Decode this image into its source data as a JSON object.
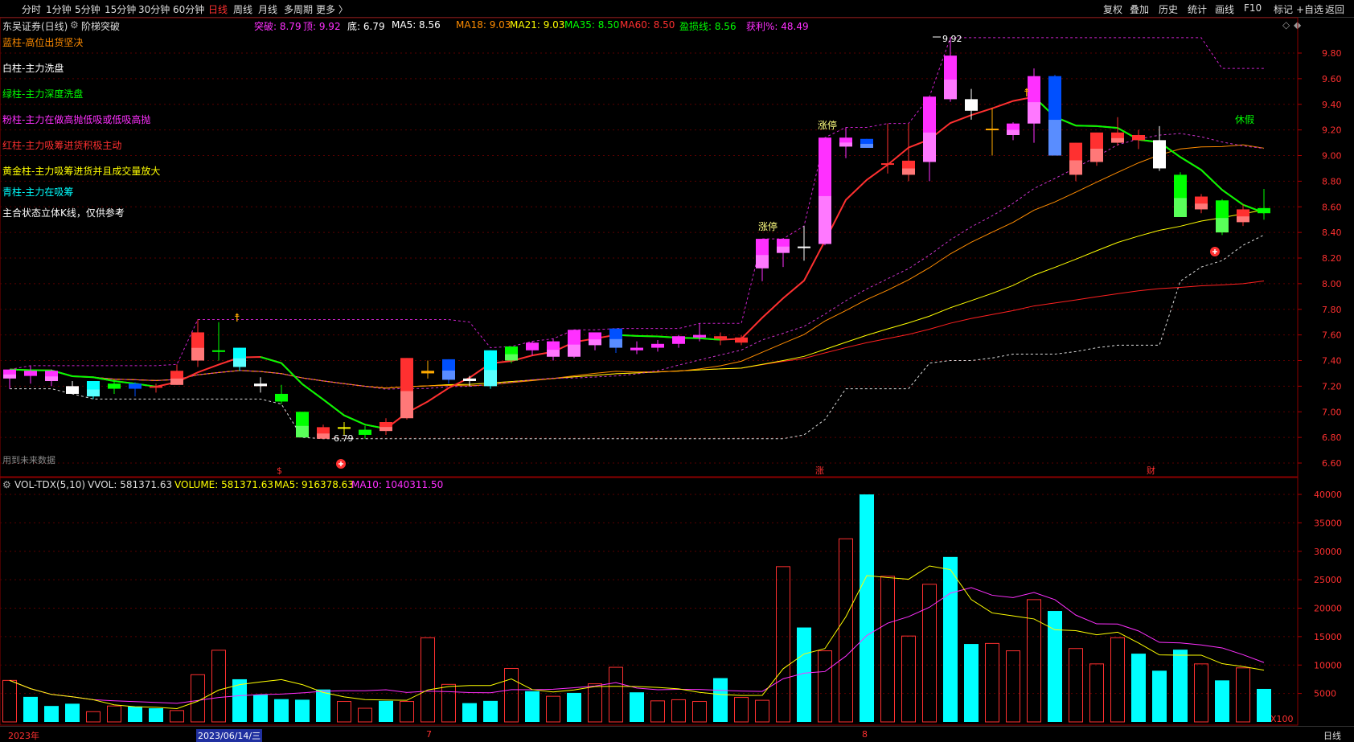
{
  "toolbar": {
    "left": [
      "分时",
      "1分钟",
      "5分钟",
      "15分钟",
      "30分钟",
      "60分钟",
      "日线",
      "周线",
      "月线",
      "多周期",
      "更多 〉"
    ],
    "active_index": 6,
    "right": [
      "复权",
      "叠加",
      "历史",
      "统计",
      "画线",
      "F10",
      "标记",
      "+自选",
      "返回"
    ]
  },
  "info": {
    "title": "东吴证券(日线)",
    "indicator_icon": "gear-icon",
    "indicator": "阶梯突破",
    "items": [
      {
        "label": "突破: ",
        "value": "8.79",
        "color": "#ff30ff"
      },
      {
        "label": "顶: ",
        "value": "9.92",
        "color": "#ff30ff"
      },
      {
        "label": "底: ",
        "value": "6.79",
        "color": "#ffffff"
      },
      {
        "label": "MA5: ",
        "value": "8.56",
        "color": "#ffffff"
      },
      {
        "label": "MA18: ",
        "value": "9.03",
        "color": "#ff8c00"
      },
      {
        "label": "MA21: ",
        "value": "9.03",
        "color": "#ffff00"
      },
      {
        "label": "MA35: ",
        "value": "8.50",
        "color": "#00ff00"
      },
      {
        "label": "MA60: ",
        "value": "8.50",
        "color": "#ff3030"
      },
      {
        "label": "盈损线: ",
        "value": "8.56",
        "color": "#00ff00"
      },
      {
        "label": "获利%: ",
        "value": "48.49",
        "color": "#ff30ff"
      }
    ],
    "right_icons": [
      "◇",
      "◆"
    ]
  },
  "legend": [
    {
      "text": "蓝柱-高位出货坚决",
      "color": "#ff8c00"
    },
    {
      "text": "白柱-主力洗盘",
      "color": "#ffffff"
    },
    {
      "text": "绿柱-主力深度洗盘",
      "color": "#00ff00"
    },
    {
      "text": "粉柱-主力在做高抛低吸或低吸高抛",
      "color": "#ff30ff"
    },
    {
      "text": "红柱-主力吸筹进货积极主动",
      "color": "#ff3030"
    },
    {
      "text": "黄金柱-主力吸筹进货并且成交量放大",
      "color": "#ffff00"
    },
    {
      "text": "青柱-主力在吸筹",
      "color": "#00ffff"
    },
    {
      "text": "主合状态立体K线，仅供参考",
      "color": "#ffffff"
    }
  ],
  "annotations": {
    "top_label": "9.92",
    "bottom_label": "6.79",
    "limit_up_1": "涨停",
    "limit_up_2": "涨停",
    "holiday": "休假",
    "future_data": "用到未来数据",
    "marker_s": "$",
    "marker_zhang": "涨",
    "marker_cai": "财"
  },
  "price_axis": [
    "9.80",
    "9.60",
    "9.40",
    "9.20",
    "9.00",
    "8.80",
    "8.60",
    "8.40",
    "8.20",
    "8.00",
    "7.80",
    "7.60",
    "7.40",
    "7.20",
    "7.00",
    "6.80",
    "6.60"
  ],
  "volume_info": {
    "name": "VOL-TDX(5,10)",
    "vvol": "VVOL: 581371.63",
    "volume": "VOLUME: 581371.63",
    "ma5": "MA5: 916378.63",
    "ma10": "MA10: 1040311.50"
  },
  "volume_axis": [
    "40000",
    "35000",
    "30000",
    "25000",
    "20000",
    "15000",
    "10000",
    "5000"
  ],
  "volume_unit": "X100",
  "date_bar": {
    "year": "2023年",
    "cursor_date": "2023/06/14/三",
    "month_7": "7",
    "month_8": "8",
    "period": "日线"
  },
  "chart_data": {
    "type": "candlestick",
    "price_range": [
      6.55,
      9.92
    ],
    "volume_range": [
      0,
      41000
    ],
    "candles": [
      {
        "o": 7.26,
        "h": 7.33,
        "l": 7.18,
        "c": 7.33,
        "color": "#ff30ff"
      },
      {
        "o": 7.28,
        "h": 7.36,
        "l": 7.22,
        "c": 7.32,
        "color": "#ff30ff"
      },
      {
        "o": 7.24,
        "h": 7.33,
        "l": 7.2,
        "c": 7.32,
        "color": "#ff30ff"
      },
      {
        "o": 7.2,
        "h": 7.24,
        "l": 7.14,
        "c": 7.14,
        "color": "#ffffff"
      },
      {
        "o": 7.12,
        "h": 7.24,
        "l": 7.1,
        "c": 7.24,
        "color": "#00ffff"
      },
      {
        "o": 7.22,
        "h": 7.25,
        "l": 7.14,
        "c": 7.18,
        "color": "#00ff00"
      },
      {
        "o": 7.18,
        "h": 7.23,
        "l": 7.12,
        "c": 7.22,
        "color": "#0050ff"
      },
      {
        "o": 7.19,
        "h": 7.22,
        "l": 7.15,
        "c": 7.2,
        "color": "#ff3030"
      },
      {
        "o": 7.21,
        "h": 7.37,
        "l": 7.21,
        "c": 7.32,
        "color": "#ff3030"
      },
      {
        "o": 7.4,
        "h": 7.72,
        "l": 7.35,
        "c": 7.62,
        "color": "#ff3030"
      },
      {
        "o": 7.48,
        "h": 7.7,
        "l": 7.4,
        "c": 7.48,
        "color": "#00ff00"
      },
      {
        "o": 7.35,
        "h": 7.5,
        "l": 7.32,
        "c": 7.5,
        "color": "#00ffff"
      },
      {
        "o": 7.2,
        "h": 7.27,
        "l": 7.15,
        "c": 7.22,
        "color": "#ffffff"
      },
      {
        "o": 7.14,
        "h": 7.21,
        "l": 7.06,
        "c": 7.08,
        "color": "#00ff00"
      },
      {
        "o": 7.0,
        "h": 7.0,
        "l": 6.8,
        "c": 6.8,
        "color": "#00ff00"
      },
      {
        "o": 6.79,
        "h": 6.9,
        "l": 6.79,
        "c": 6.88,
        "color": "#ff3030"
      },
      {
        "o": 6.88,
        "h": 6.92,
        "l": 6.82,
        "c": 6.88,
        "color": "#ffff00"
      },
      {
        "o": 6.82,
        "h": 6.89,
        "l": 6.79,
        "c": 6.86,
        "color": "#00ff00"
      },
      {
        "o": 6.85,
        "h": 6.95,
        "l": 6.82,
        "c": 6.92,
        "color": "#ff3030"
      },
      {
        "o": 6.95,
        "h": 7.42,
        "l": 6.94,
        "c": 7.42,
        "color": "#ff3030"
      },
      {
        "o": 7.3,
        "h": 7.4,
        "l": 7.26,
        "c": 7.32,
        "color": "#ffaa00"
      },
      {
        "o": 7.25,
        "h": 7.41,
        "l": 7.22,
        "c": 7.41,
        "color": "#0050ff"
      },
      {
        "o": 7.24,
        "h": 7.28,
        "l": 7.2,
        "c": 7.26,
        "color": "#ffffff"
      },
      {
        "o": 7.2,
        "h": 7.48,
        "l": 7.18,
        "c": 7.48,
        "color": "#00ffff"
      },
      {
        "o": 7.4,
        "h": 7.51,
        "l": 7.38,
        "c": 7.51,
        "color": "#00ff00"
      },
      {
        "o": 7.48,
        "h": 7.55,
        "l": 7.44,
        "c": 7.54,
        "color": "#ff30ff"
      },
      {
        "o": 7.43,
        "h": 7.57,
        "l": 7.4,
        "c": 7.55,
        "color": "#ff30ff"
      },
      {
        "o": 7.43,
        "h": 7.64,
        "l": 7.42,
        "c": 7.64,
        "color": "#ff30ff"
      },
      {
        "o": 7.52,
        "h": 7.62,
        "l": 7.48,
        "c": 7.62,
        "color": "#ff30ff"
      },
      {
        "o": 7.5,
        "h": 7.65,
        "l": 7.46,
        "c": 7.65,
        "color": "#0050ff"
      },
      {
        "o": 7.48,
        "h": 7.55,
        "l": 7.45,
        "c": 7.5,
        "color": "#ff30ff"
      },
      {
        "o": 7.5,
        "h": 7.56,
        "l": 7.47,
        "c": 7.53,
        "color": "#ff30ff"
      },
      {
        "o": 7.53,
        "h": 7.6,
        "l": 7.5,
        "c": 7.59,
        "color": "#ff30ff"
      },
      {
        "o": 7.58,
        "h": 7.69,
        "l": 7.55,
        "c": 7.6,
        "color": "#ff30ff"
      },
      {
        "o": 7.57,
        "h": 7.62,
        "l": 7.52,
        "c": 7.59,
        "color": "#ff3030"
      },
      {
        "o": 7.58,
        "h": 7.6,
        "l": 7.52,
        "c": 7.54,
        "color": "#ff3030"
      },
      {
        "o": 8.12,
        "h": 8.35,
        "l": 8.02,
        "c": 8.35,
        "color": "#ff30ff"
      },
      {
        "o": 8.24,
        "h": 8.35,
        "l": 8.13,
        "c": 8.35,
        "color": "#ff30ff"
      },
      {
        "o": 8.29,
        "h": 8.45,
        "l": 8.18,
        "c": 8.29,
        "color": "#ffffff"
      },
      {
        "o": 8.31,
        "h": 9.14,
        "l": 8.3,
        "c": 9.14,
        "color": "#ff30ff"
      },
      {
        "o": 9.07,
        "h": 9.22,
        "l": 8.98,
        "c": 9.14,
        "color": "#ff30ff"
      },
      {
        "o": 9.06,
        "h": 9.13,
        "l": 9.06,
        "c": 9.13,
        "color": "#0050ff"
      },
      {
        "o": 8.94,
        "h": 9.25,
        "l": 8.86,
        "c": 8.94,
        "color": "#ff3030"
      },
      {
        "o": 8.85,
        "h": 9.25,
        "l": 8.8,
        "c": 8.96,
        "color": "#ff3030"
      },
      {
        "o": 8.95,
        "h": 9.46,
        "l": 8.8,
        "c": 9.46,
        "color": "#ff30ff"
      },
      {
        "o": 9.44,
        "h": 9.92,
        "l": 9.42,
        "c": 9.78,
        "color": "#ff30ff"
      },
      {
        "o": 9.35,
        "h": 9.52,
        "l": 9.28,
        "c": 9.44,
        "color": "#ffffff"
      },
      {
        "o": 9.21,
        "h": 9.37,
        "l": 9.0,
        "c": 9.2,
        "color": "#ffaa00"
      },
      {
        "o": 9.16,
        "h": 9.26,
        "l": 9.12,
        "c": 9.25,
        "color": "#ff30ff"
      },
      {
        "o": 9.25,
        "h": 9.68,
        "l": 9.1,
        "c": 9.62,
        "color": "#ff30ff"
      },
      {
        "o": 9.62,
        "h": 9.63,
        "l": 9.0,
        "c": 9.0,
        "color": "#0050ff"
      },
      {
        "o": 8.85,
        "h": 9.1,
        "l": 8.8,
        "c": 9.1,
        "color": "#ff3030"
      },
      {
        "o": 8.95,
        "h": 9.18,
        "l": 8.92,
        "c": 9.18,
        "color": "#ff3030"
      },
      {
        "o": 9.1,
        "h": 9.3,
        "l": 9.08,
        "c": 9.18,
        "color": "#ff3030"
      },
      {
        "o": 9.12,
        "h": 9.2,
        "l": 9.05,
        "c": 9.16,
        "color": "#ff3030"
      },
      {
        "o": 9.12,
        "h": 9.23,
        "l": 8.88,
        "c": 8.9,
        "color": "#ffffff"
      },
      {
        "o": 8.85,
        "h": 8.87,
        "l": 8.52,
        "c": 8.52,
        "color": "#00ff00"
      },
      {
        "o": 8.58,
        "h": 8.7,
        "l": 8.55,
        "c": 8.68,
        "color": "#ff3030"
      },
      {
        "o": 8.65,
        "h": 8.66,
        "l": 8.38,
        "c": 8.4,
        "color": "#00ff00"
      },
      {
        "o": 8.48,
        "h": 8.62,
        "l": 8.45,
        "c": 8.58,
        "color": "#ff3030"
      },
      {
        "o": 8.55,
        "h": 8.74,
        "l": 8.5,
        "c": 8.59,
        "color": "#00ff00"
      }
    ],
    "volumes": [
      {
        "v": 7300,
        "t": "hollow"
      },
      {
        "v": 4400,
        "t": "solid"
      },
      {
        "v": 2800,
        "t": "solid"
      },
      {
        "v": 3200,
        "t": "solid"
      },
      {
        "v": 1800,
        "t": "hollow"
      },
      {
        "v": 2800,
        "t": "hollow"
      },
      {
        "v": 2700,
        "t": "solid"
      },
      {
        "v": 2400,
        "t": "solid"
      },
      {
        "v": 2000,
        "t": "hollow"
      },
      {
        "v": 8300,
        "t": "hollow"
      },
      {
        "v": 12600,
        "t": "hollow"
      },
      {
        "v": 7500,
        "t": "solid"
      },
      {
        "v": 4800,
        "t": "solid"
      },
      {
        "v": 4000,
        "t": "solid"
      },
      {
        "v": 3900,
        "t": "solid"
      },
      {
        "v": 5700,
        "t": "solid"
      },
      {
        "v": 3600,
        "t": "hollow"
      },
      {
        "v": 2400,
        "t": "hollow"
      },
      {
        "v": 3700,
        "t": "solid"
      },
      {
        "v": 3600,
        "t": "hollow"
      },
      {
        "v": 14800,
        "t": "hollow"
      },
      {
        "v": 6600,
        "t": "hollow"
      },
      {
        "v": 3300,
        "t": "solid"
      },
      {
        "v": 3700,
        "t": "solid"
      },
      {
        "v": 9400,
        "t": "hollow"
      },
      {
        "v": 5400,
        "t": "solid"
      },
      {
        "v": 4500,
        "t": "hollow"
      },
      {
        "v": 5100,
        "t": "solid"
      },
      {
        "v": 6700,
        "t": "hollow"
      },
      {
        "v": 9600,
        "t": "hollow"
      },
      {
        "v": 5200,
        "t": "solid"
      },
      {
        "v": 3700,
        "t": "hollow"
      },
      {
        "v": 3900,
        "t": "hollow"
      },
      {
        "v": 3600,
        "t": "hollow"
      },
      {
        "v": 7700,
        "t": "solid"
      },
      {
        "v": 4300,
        "t": "hollow"
      },
      {
        "v": 3800,
        "t": "hollow"
      },
      {
        "v": 27300,
        "t": "hollow"
      },
      {
        "v": 16600,
        "t": "solid"
      },
      {
        "v": 12500,
        "t": "hollow"
      },
      {
        "v": 32200,
        "t": "hollow"
      },
      {
        "v": 40000,
        "t": "solid"
      },
      {
        "v": 25600,
        "t": "hollow"
      },
      {
        "v": 15100,
        "t": "hollow"
      },
      {
        "v": 24200,
        "t": "hollow"
      },
      {
        "v": 29000,
        "t": "solid"
      },
      {
        "v": 13700,
        "t": "solid"
      },
      {
        "v": 13800,
        "t": "hollow"
      },
      {
        "v": 12500,
        "t": "hollow"
      },
      {
        "v": 21500,
        "t": "hollow"
      },
      {
        "v": 19500,
        "t": "solid"
      },
      {
        "v": 12900,
        "t": "hollow"
      },
      {
        "v": 10200,
        "t": "hollow"
      },
      {
        "v": 14800,
        "t": "hollow"
      },
      {
        "v": 12000,
        "t": "solid"
      },
      {
        "v": 9000,
        "t": "solid"
      },
      {
        "v": 12700,
        "t": "solid"
      },
      {
        "v": 10200,
        "t": "hollow"
      },
      {
        "v": 7300,
        "t": "solid"
      },
      {
        "v": 9500,
        "t": "hollow"
      },
      {
        "v": 5800,
        "t": "solid"
      }
    ]
  }
}
